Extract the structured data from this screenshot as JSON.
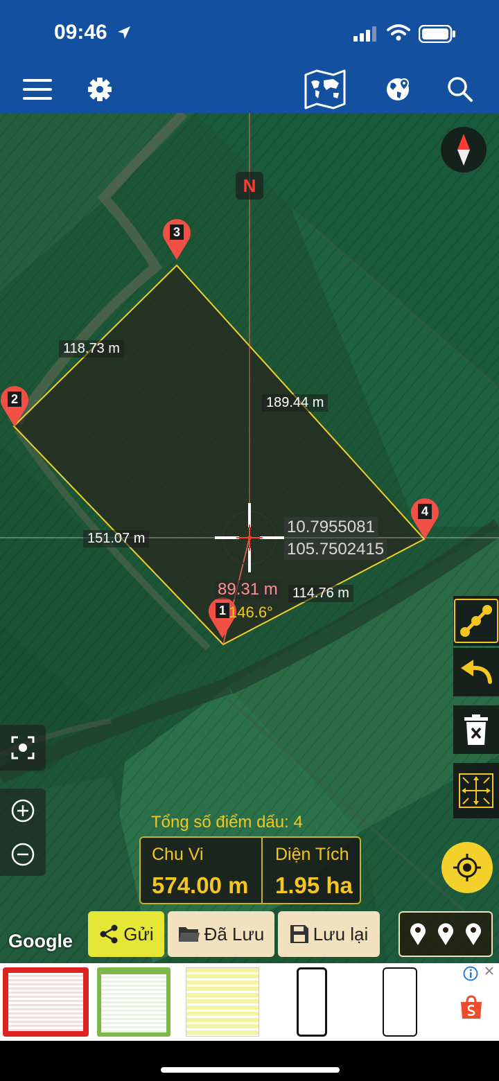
{
  "status_bar": {
    "time": "09:46"
  },
  "map": {
    "north_label": "N",
    "points": [
      {
        "number": "1"
      },
      {
        "number": "2"
      },
      {
        "number": "3"
      },
      {
        "number": "4"
      }
    ],
    "edge_lengths": {
      "p3_p2": "118.73 m",
      "p3_p4": "189.44 m",
      "p2_p1": "151.07 m",
      "p1_p4": "114.76 m"
    },
    "crosshair": {
      "lat": "10.7955081",
      "lon": "105.7502415"
    },
    "current_segment": {
      "length": "89.31 m",
      "angle": "146.6°"
    },
    "summary": {
      "count_label": "Tổng số điểm dấu: 4",
      "perimeter_label": "Chu Vi",
      "perimeter_value": "574.00 m",
      "area_label": "Diện Tích",
      "area_value": "1.95 ha"
    },
    "attribution": "Google"
  },
  "actions": {
    "send": "Gửi",
    "saved": "Đã Lưu",
    "save": "Lưu lại"
  },
  "colors": {
    "header": "#1450a0",
    "accent_yellow": "#f3c622",
    "pin_red": "#f25044",
    "send_button": "#e6e637",
    "button_beige": "#f2e1bf"
  }
}
